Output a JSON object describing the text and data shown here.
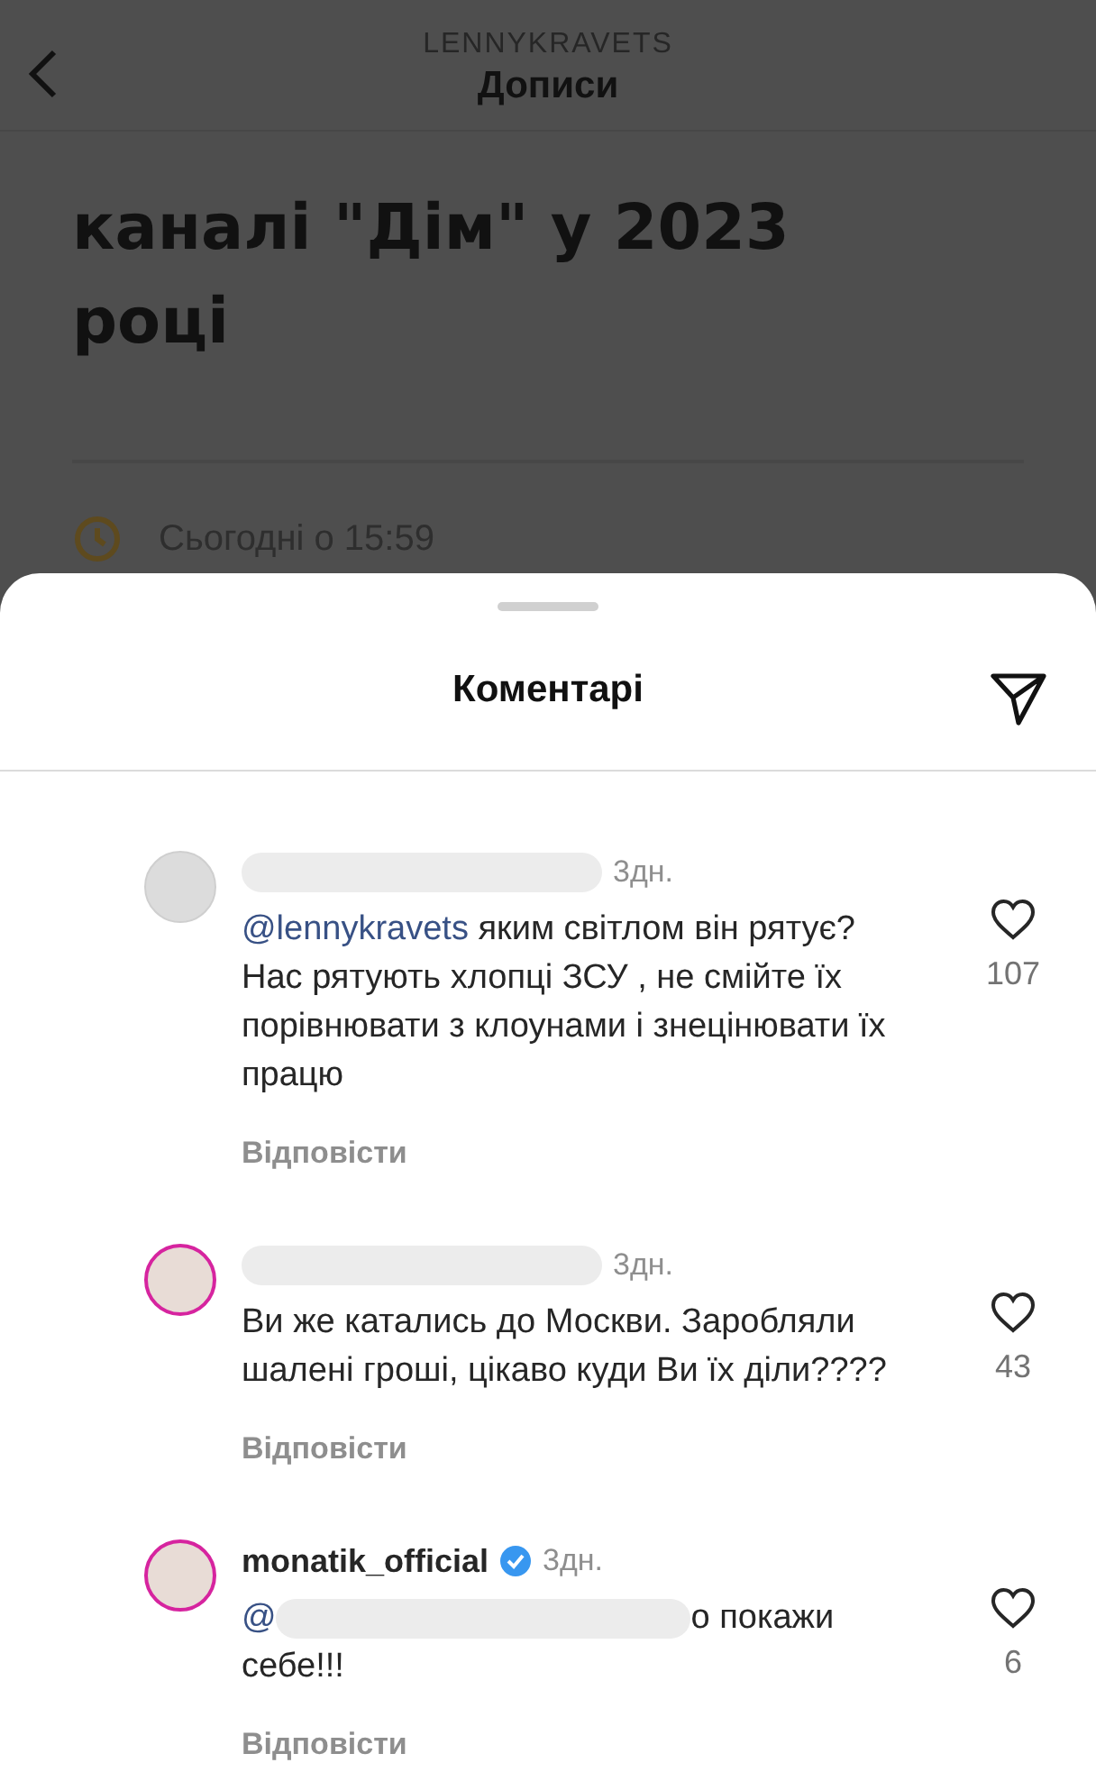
{
  "header": {
    "account": "LENNYKRAVETS",
    "title": "Дописи"
  },
  "article": {
    "title_lines": [
      "каналі \"Дім\" у 2023",
      "році"
    ],
    "date": "Сьогодні о 15:59"
  },
  "sheet": {
    "title": "Коментарі"
  },
  "comments": [
    {
      "avatar_photo": false,
      "username_redacted": true,
      "verified": false,
      "time": "3дн.",
      "mention": "@lennykravets",
      "text": "яким світлом він рятує? Нас рятують хлопці ЗСУ , не смійте їх порівнювати з клоунами і знецінювати їх працю",
      "mention_redacted": false,
      "reply": "Відповісти",
      "likes": "107"
    },
    {
      "avatar_photo": true,
      "username_redacted": true,
      "verified": false,
      "time": "3дн.",
      "text": "Ви же катались до Москви. Заробляли шалені гроші, цікаво куди Ви їх діли????",
      "mention_redacted": false,
      "reply": "Відповісти",
      "likes": "43"
    },
    {
      "avatar_photo": true,
      "username_redacted": false,
      "username": "monatik_official",
      "verified": true,
      "time": "3дн.",
      "mention": "@",
      "mention_redacted": true,
      "text": "о покажи себе!!!",
      "reply": "Відповісти",
      "likes": "6"
    }
  ]
}
